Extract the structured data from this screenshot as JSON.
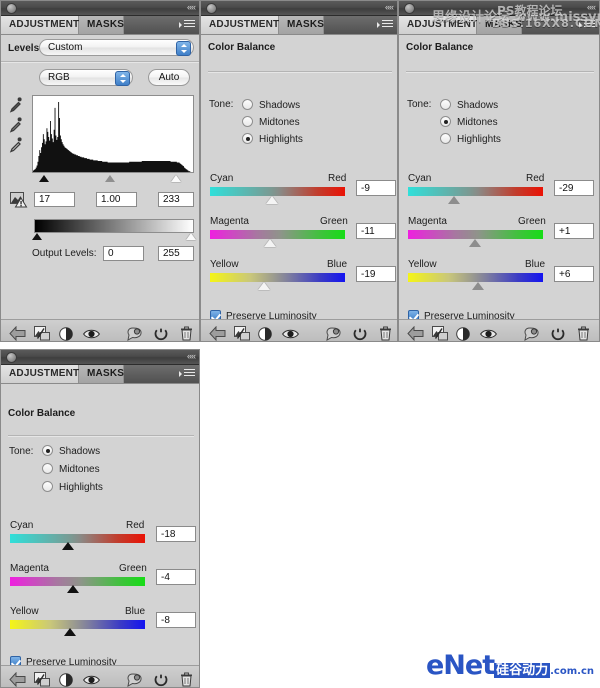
{
  "window": {
    "tab_adjustments": "ADJUSTMENTS",
    "tab_masks": "MASKS"
  },
  "panels": {
    "levels": {
      "title": "Levels",
      "preset_value": "Custom",
      "channel_value": "RGB",
      "auto_label": "Auto",
      "input_shadow": "17",
      "input_gamma": "1.00",
      "input_highlight": "233",
      "output_label": "Output Levels:",
      "output_black": "0",
      "output_white": "255",
      "histogram": [
        2,
        3,
        4,
        6,
        9,
        14,
        22,
        30,
        26,
        34,
        40,
        52,
        45,
        38,
        42,
        60,
        55,
        48,
        43,
        70,
        52,
        46,
        41,
        58,
        88,
        50,
        44,
        48,
        96,
        74,
        50,
        45,
        41,
        38,
        36,
        34,
        33,
        32,
        31,
        30,
        29,
        28,
        27,
        26,
        25,
        25,
        24,
        24,
        23,
        23,
        22,
        22,
        21,
        21,
        20,
        20,
        20,
        19,
        19,
        19,
        18,
        18,
        18,
        17,
        17,
        17,
        17,
        16,
        16,
        16,
        16,
        16,
        15,
        15,
        15,
        15,
        15,
        14,
        14,
        14,
        14,
        14,
        14,
        13,
        13,
        13,
        13,
        13,
        13,
        13,
        13,
        13,
        13,
        13,
        13,
        13,
        13,
        13,
        13,
        13,
        13,
        13,
        13,
        13,
        13,
        13,
        13,
        14,
        14,
        14,
        14,
        14,
        14,
        14,
        14,
        14,
        14,
        14,
        14,
        14,
        14,
        15,
        15,
        15,
        15,
        15,
        15,
        15,
        15,
        15,
        15,
        15,
        15,
        15,
        15,
        15,
        15,
        15,
        15,
        15,
        15,
        15,
        15,
        15,
        15,
        15,
        15,
        15,
        15,
        15,
        15,
        15,
        15,
        14,
        14,
        14,
        14,
        14,
        14,
        14,
        13,
        13,
        13,
        12,
        11,
        10,
        9,
        8,
        6,
        5,
        4,
        3,
        2,
        1,
        1,
        0,
        0,
        0
      ]
    },
    "color_balance_highlights": {
      "title": "Color Balance",
      "tone_label": "Tone:",
      "tones": [
        {
          "label": "Shadows",
          "selected": false
        },
        {
          "label": "Midtones",
          "selected": false
        },
        {
          "label": "Highlights",
          "selected": true
        }
      ],
      "sliders": [
        {
          "left": "Cyan",
          "right": "Red",
          "value": "-9",
          "pos": 42
        },
        {
          "left": "Magenta",
          "right": "Green",
          "value": "-11",
          "pos": 41
        },
        {
          "left": "Yellow",
          "right": "Blue",
          "value": "-19",
          "pos": 38
        }
      ],
      "preserve_label": "Preserve Luminosity",
      "preserve_checked": true,
      "knob_style": "white"
    },
    "color_balance_midtones": {
      "title": "Color Balance",
      "tone_label": "Tone:",
      "tones": [
        {
          "label": "Shadows",
          "selected": false
        },
        {
          "label": "Midtones",
          "selected": true
        },
        {
          "label": "Highlights",
          "selected": false
        }
      ],
      "sliders": [
        {
          "left": "Cyan",
          "right": "Red",
          "value": "-29",
          "pos": 33
        },
        {
          "left": "Magenta",
          "right": "Green",
          "value": "+1",
          "pos": 51
        },
        {
          "left": "Yellow",
          "right": "Blue",
          "value": "+6",
          "pos": 54
        }
      ],
      "preserve_label": "Preserve Luminosity",
      "preserve_checked": true,
      "knob_style": "gray"
    },
    "color_balance_shadows": {
      "title": "Color Balance",
      "tone_label": "Tone:",
      "tones": [
        {
          "label": "Shadows",
          "selected": true
        },
        {
          "label": "Midtones",
          "selected": false
        },
        {
          "label": "Highlights",
          "selected": false
        }
      ],
      "sliders": [
        {
          "left": "Cyan",
          "right": "Red",
          "value": "-18",
          "pos": 39
        },
        {
          "left": "Magenta",
          "right": "Green",
          "value": "-4",
          "pos": 47
        },
        {
          "left": "Yellow",
          "right": "Blue",
          "value": "-8",
          "pos": 44
        }
      ],
      "preserve_label": "Preserve Luminosity",
      "preserve_checked": true,
      "knob_style": "black"
    }
  },
  "toolbar_icons": [
    "clip-to-layer-arrow-icon",
    "previous-state-image-icon",
    "adjustment-layer-icon",
    "toggle-visibility-eye-icon",
    "view-previous-state-icon",
    "reset-icon",
    "delete-trash-icon"
  ],
  "watermark": {
    "line1": "思缘设计论坛  www.missyuan.com",
    "line2": "PS教程论坛",
    "line3": "BBS.16XX8.COM"
  },
  "logo": {
    "text_e": "e",
    "text_net": "Net",
    "text_cn_block": "硅谷动力",
    "text_domain": ".com.cn"
  },
  "colors": {
    "panel_bg": "#d3d3d3",
    "accent_blue": "#3f7fc8",
    "logo_blue": "#2a55c4"
  }
}
